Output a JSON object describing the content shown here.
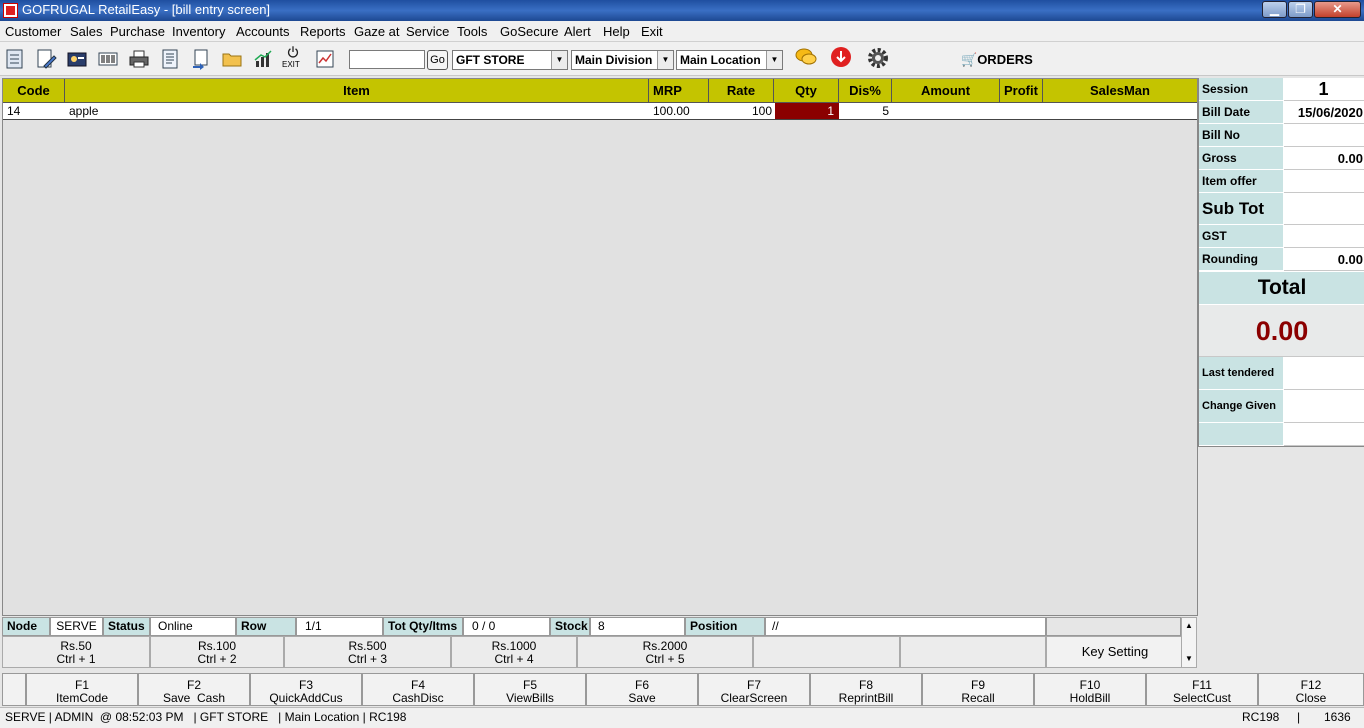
{
  "window": {
    "title": "GOFRUGAL RetailEasy - [bill entry screen]",
    "min_label": "▁",
    "max_label": "❐",
    "close_label": "✕"
  },
  "menu": [
    "Customer",
    "Sales",
    "Purchase",
    "Inventory",
    "Accounts",
    "Reports",
    "Gaze at",
    "Service",
    "Tools",
    "GoSecure",
    "Alert",
    "Help",
    "Exit"
  ],
  "toolbar": {
    "exit_label": "EXIT",
    "search_value": "",
    "go_label": "Go",
    "store": "GFT STORE",
    "division": "Main Division",
    "location": "Main Location",
    "orders_label": "ORDERS"
  },
  "grid": {
    "columns": [
      "Code",
      "Item",
      "MRP",
      "Rate",
      "Qty",
      "Dis%",
      "Amount",
      "Profit",
      "SalesMan"
    ],
    "rows": [
      {
        "code": "14",
        "item": "apple",
        "mrp": "100.00",
        "rate": "100",
        "qty": "1",
        "dis": "5",
        "amount": "",
        "profit": "",
        "salesman": ""
      }
    ]
  },
  "status_strip": {
    "node_label": "Node",
    "node_value": "SERVE",
    "status_label": "Status",
    "status_value": "Online",
    "row_label": "Row",
    "row_value": "1/1",
    "totqty_label": "Tot Qty/Itms",
    "totqty_value": "0 / 0",
    "stock_label": "Stock",
    "stock_value": "8",
    "position_label": "Position",
    "position_value": "//"
  },
  "denominations": [
    {
      "amount": "Rs.50",
      "shortcut": "Ctrl + 1"
    },
    {
      "amount": "Rs.100",
      "shortcut": "Ctrl + 2"
    },
    {
      "amount": "Rs.500",
      "shortcut": "Ctrl + 3"
    },
    {
      "amount": "Rs.1000",
      "shortcut": "Ctrl + 4"
    },
    {
      "amount": "Rs.2000",
      "shortcut": "Ctrl + 5"
    }
  ],
  "key_setting_label": "Key Setting",
  "summary": {
    "session_label": "Session",
    "session_value": "1",
    "bill_date_label": "Bill Date",
    "bill_date_value": "15/06/2020",
    "bill_no_label": "Bill No",
    "bill_no_value": "",
    "gross_label": "Gross",
    "gross_value": "0.00",
    "item_offer_label": "Item offer",
    "item_offer_value": "",
    "sub_tot_label": "Sub Tot",
    "sub_tot_value": "",
    "gst_label": "GST",
    "gst_value": "",
    "rounding_label": "Rounding",
    "rounding_value": "0.00",
    "total_label": "Total",
    "total_value": "0.00",
    "last_tendered_label": "Last tendered",
    "last_tendered_value": "",
    "change_given_label": "Change Given",
    "change_given_value": ""
  },
  "function_keys": [
    {
      "key": "F1",
      "label": "ItemCode"
    },
    {
      "key": "F2",
      "label": "Save  Cash"
    },
    {
      "key": "F3",
      "label": "QuickAddCus"
    },
    {
      "key": "F4",
      "label": "CashDisc"
    },
    {
      "key": "F5",
      "label": "ViewBills"
    },
    {
      "key": "F6",
      "label": "Save"
    },
    {
      "key": "F7",
      "label": "ClearScreen"
    },
    {
      "key": "F8",
      "label": "ReprintBill"
    },
    {
      "key": "F9",
      "label": "Recall"
    },
    {
      "key": "F10",
      "label": "HoldBill"
    },
    {
      "key": "F11",
      "label": "SelectCust"
    },
    {
      "key": "F12",
      "label": "Close"
    }
  ],
  "statusbar": {
    "left": "SERVE | ADMIN  @ 08:52:03 PM   | GFT STORE   | Main Location | RC198",
    "right_code": "RC198",
    "right_sep": "|",
    "right_num": "1636"
  },
  "colors": {
    "grid_header": "#c4c400",
    "qty_cell": "#8b0000",
    "label_bg": "#c9e3e3",
    "total_text": "#8b0000",
    "titlebar": "#1f4fa0"
  }
}
